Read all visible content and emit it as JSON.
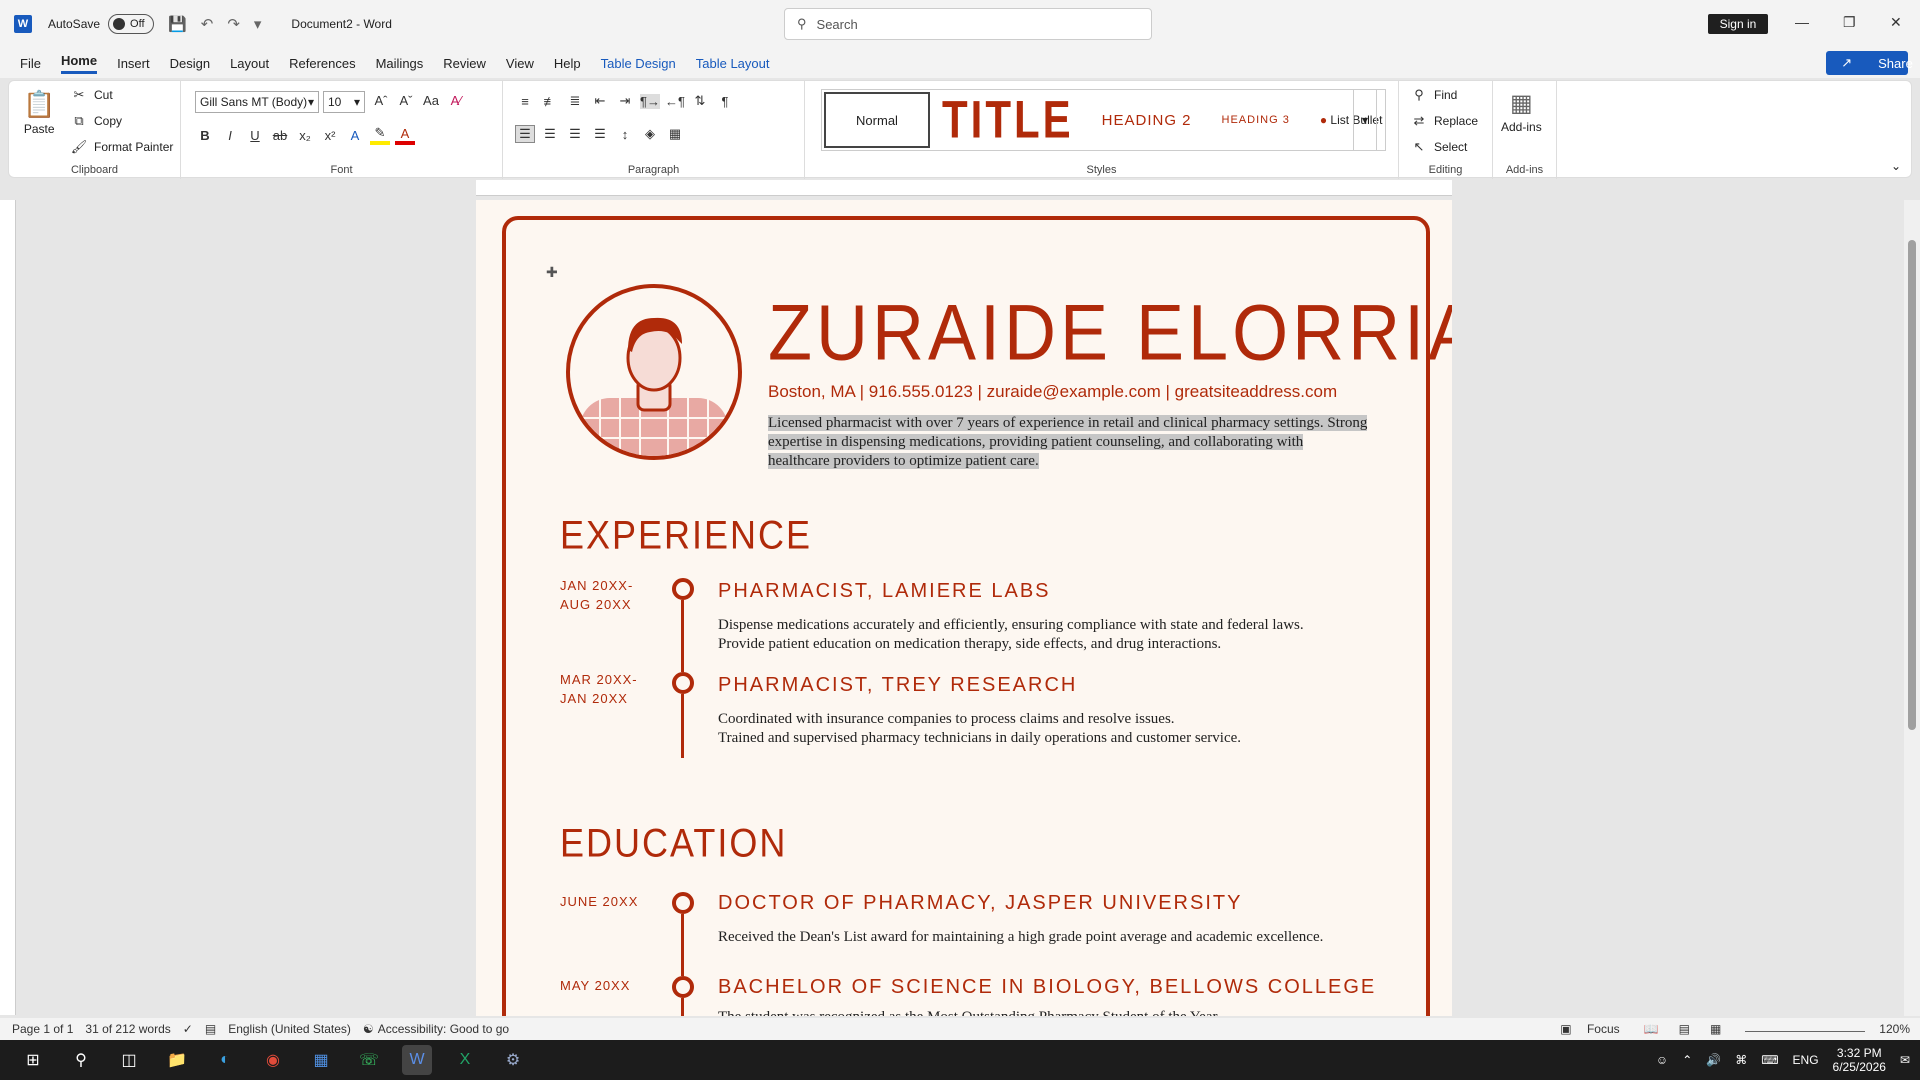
{
  "app": {
    "title": "Document2 - Word",
    "autosave_label": "AutoSave",
    "autosave_state": "Off",
    "search_placeholder": "Search",
    "signin": "Sign in",
    "share": "Share"
  },
  "menu": [
    "File",
    "Home",
    "Insert",
    "Design",
    "Layout",
    "References",
    "Mailings",
    "Review",
    "View",
    "Help",
    "Table Design",
    "Table Layout"
  ],
  "ribbon": {
    "clipboard": {
      "paste": "Paste",
      "cut": "Cut",
      "copy": "Copy",
      "format_painter": "Format Painter",
      "label": "Clipboard"
    },
    "font": {
      "family": "Gill Sans MT (Body)",
      "size": "10",
      "label": "Font"
    },
    "paragraph": {
      "label": "Paragraph"
    },
    "styles": {
      "normal": "Normal",
      "title": "TITLE",
      "h2": "HEADING 2",
      "h3": "HEADING 3",
      "list_bullet": "List Bullet",
      "label": "Styles"
    },
    "editing": {
      "find": "Find",
      "replace": "Replace",
      "select": "Select",
      "label": "Editing"
    },
    "addins": {
      "button": "Add-ins",
      "label": "Add-ins"
    }
  },
  "resume": {
    "name": "ZURAIDE ELORRIAGA",
    "contact": "Boston, MA | 916.555.0123 | zuraide@example.com | greatsiteaddress.com",
    "summary": "Licensed pharmacist with over 7 years of experience in retail and clinical pharmacy settings. Strong expertise in dispensing medications, providing patient counseling, and collaborating with healthcare providers to optimize patient care.",
    "experience_heading": "EXPERIENCE",
    "experience": [
      {
        "date1": "JAN 20XX-",
        "date2": "AUG 20XX",
        "title": "PHARMACIST, LAMIERE LABS",
        "line1": "Dispense medications accurately and efficiently, ensuring compliance with state and federal laws.",
        "line2": "Provide patient education on medication therapy, side effects, and drug interactions."
      },
      {
        "date1": "MAR 20XX-",
        "date2": "JAN 20XX",
        "title": "PHARMACIST, TREY RESEARCH",
        "line1": "Coordinated with insurance companies to process claims and resolve issues.",
        "line2": "Trained and supervised pharmacy technicians in daily operations and customer service."
      }
    ],
    "education_heading": "EDUCATION",
    "education": [
      {
        "date": "JUNE 20XX",
        "title": "DOCTOR OF PHARMACY, JASPER UNIVERSITY",
        "line1": "Received the Dean's List award for maintaining a high grade point average and academic excellence."
      },
      {
        "date": "MAY 20XX",
        "title": "BACHELOR OF SCIENCE IN BIOLOGY, BELLOWS COLLEGE",
        "line1": "The student was recognized as the Most Outstanding Pharmacy Student of the Year"
      }
    ]
  },
  "status": {
    "page": "Page 1 of 1",
    "words": "31 of 212 words",
    "language": "English (United States)",
    "accessibility": "Accessibility: Good to go",
    "focus": "Focus",
    "zoom": "120%"
  },
  "taskbar": {
    "lang": "ENG",
    "time": "3:32 PM",
    "date": "6/25/2026"
  },
  "colors": {
    "accent": "#b02a0a",
    "word_blue": "#185abd"
  }
}
